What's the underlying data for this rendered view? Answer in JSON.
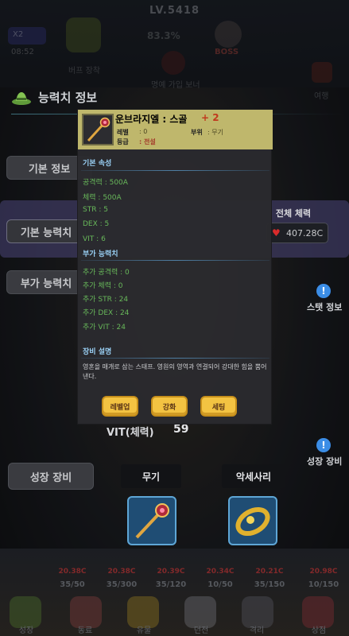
{
  "top": {
    "level": "LV.5418",
    "progress": "83.3%",
    "badge": "X2",
    "timer": "08:52",
    "boss": "BOSS",
    "icons": {
      "left_label": "버프 장착",
      "mid_label": "명예 가입 보너",
      "right_label": "여행"
    }
  },
  "header": {
    "title": "능력치 정보",
    "icon": "hat-icon"
  },
  "side_menu": [
    {
      "label": "기본 정보"
    },
    {
      "label": "기본 능력치"
    },
    {
      "label": "부가 능력치"
    }
  ],
  "total_hp": {
    "label": "전체 체력",
    "value": "407.28C",
    "icon": "heart-icon"
  },
  "stat_info": {
    "label": "스탯 정보"
  },
  "growth_info": {
    "label": "성장 장비"
  },
  "vit": {
    "label": "VIT(체력)",
    "value": "59"
  },
  "growth_equip": {
    "button": "성장 장비",
    "weapon_tab": "무기",
    "accessory_tab": "악세사리"
  },
  "bottom_bar": {
    "costs": [
      "20.38C",
      "20.38C",
      "20.39C",
      "20.34C",
      "20.21C",
      "20.98C"
    ],
    "counts": [
      "35/50",
      "35/300",
      "35/120",
      "10/50",
      "35/150",
      "10/150"
    ],
    "labels": [
      "성장",
      "동료",
      "유물",
      "던전",
      "격리",
      "상점"
    ]
  },
  "popup": {
    "item_name": "운브라지엘 : 스골",
    "plus": "+ 2",
    "level_label": "레벨",
    "level_value": ": 0",
    "part_label": "부위",
    "part_value": ": 무기",
    "grade_label": "등급",
    "grade_value": ": 전설",
    "basic_title": "기본 속성",
    "basic_stats": [
      "공격력 : 500A",
      "체력 : 500A",
      "STR : 5",
      "DEX : 5",
      "VIT : 6"
    ],
    "extra_title": "부가 능력치",
    "extra_stats": [
      "추가 공격력 : 0",
      "추가 체력 : 0",
      "추가 STR : 24",
      "추가 DEX : 24",
      "추가 VIT : 24"
    ],
    "desc_title": "장비 설명",
    "desc": "영혼을 매개로 삼는 스태프. 영원의 영역과 연결되어 강대한 힘을 뿜어낸다.",
    "buttons": [
      "레벨업",
      "강화",
      "세팅"
    ]
  },
  "colors": {
    "popup_header": "#bfb76c",
    "stat_green": "#68b85a",
    "section_blue": "#9ad1f6",
    "button_yellow": "#f3c342",
    "slot_blue": "#1f4d74"
  }
}
